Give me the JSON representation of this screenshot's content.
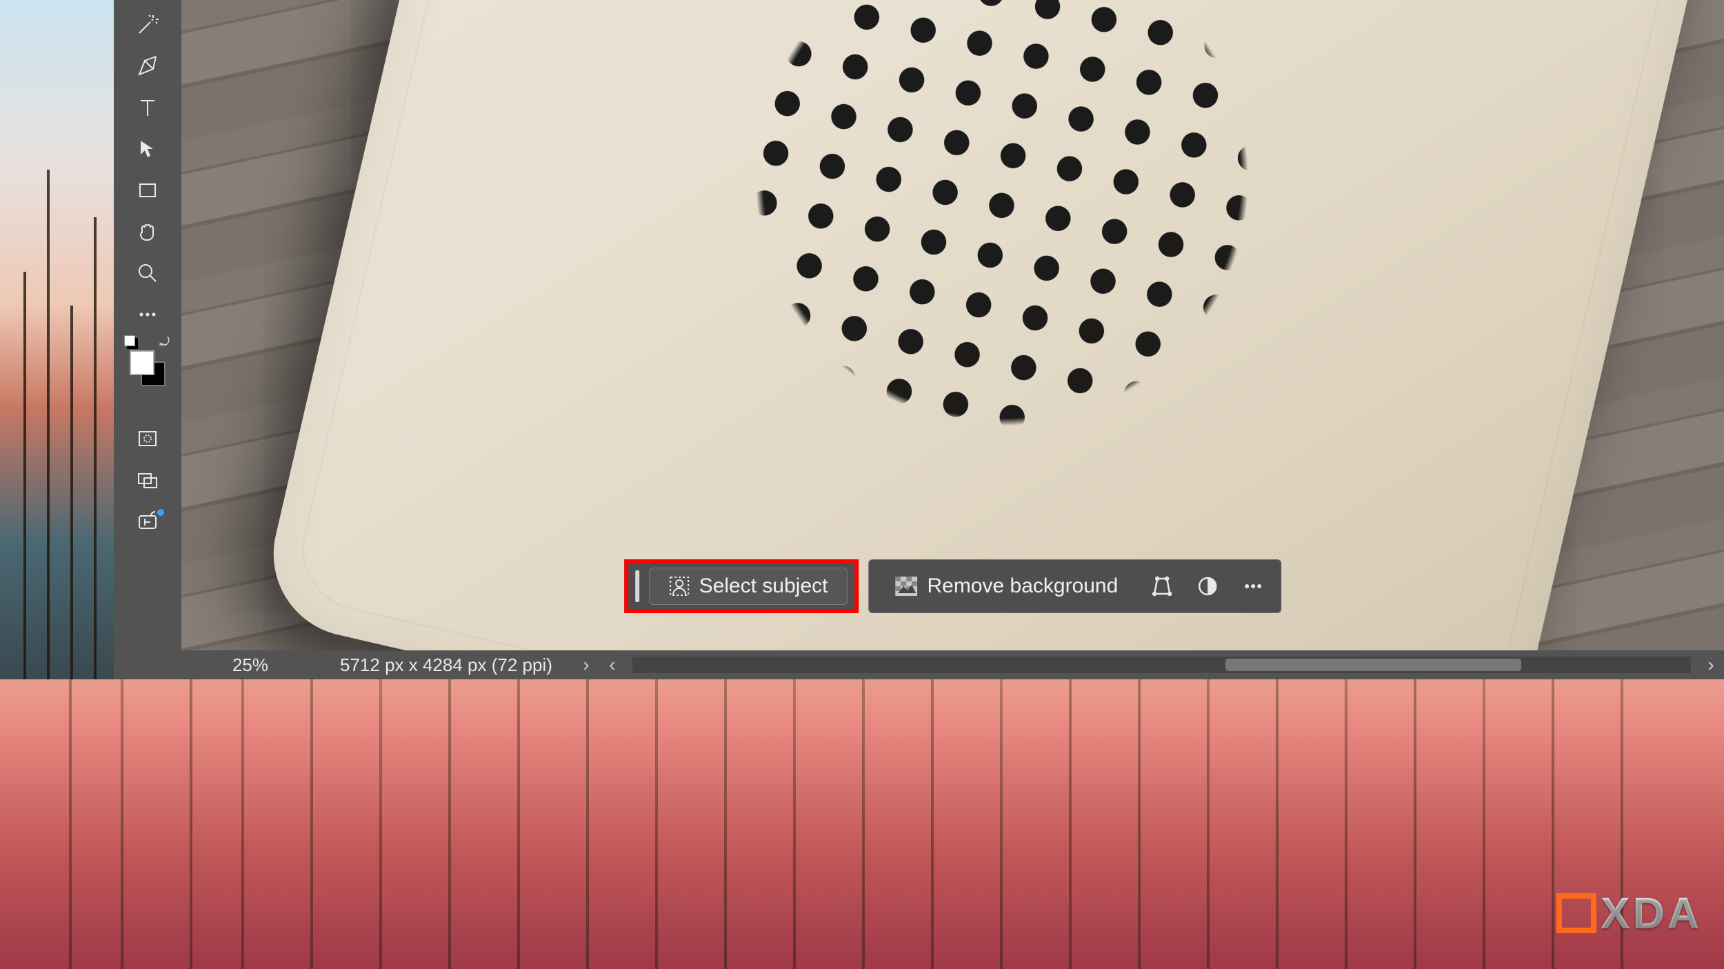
{
  "toolbox": {
    "tools": [
      {
        "name": "magic-wand-tool"
      },
      {
        "name": "pen-tool"
      },
      {
        "name": "type-tool"
      },
      {
        "name": "path-selection-tool"
      },
      {
        "name": "rectangle-tool"
      },
      {
        "name": "hand-tool"
      },
      {
        "name": "zoom-tool"
      },
      {
        "name": "edit-toolbar"
      }
    ],
    "swatch": {
      "foreground": "#ffffff",
      "background": "#000000"
    },
    "footer_tools": [
      {
        "name": "quick-mask-tool"
      },
      {
        "name": "screen-mode-tool"
      },
      {
        "name": "frame-io-tool",
        "has_notification": true
      }
    ]
  },
  "context_bar": {
    "select_subject_label": "Select subject",
    "remove_background_label": "Remove background"
  },
  "statusbar": {
    "zoom": "25%",
    "dimensions": "5712 px x 4284 px (72 ppi)"
  },
  "annotation": {
    "highlight": "select-subject",
    "highlight_color": "#ff0000"
  },
  "watermark": {
    "text": "XDA"
  }
}
